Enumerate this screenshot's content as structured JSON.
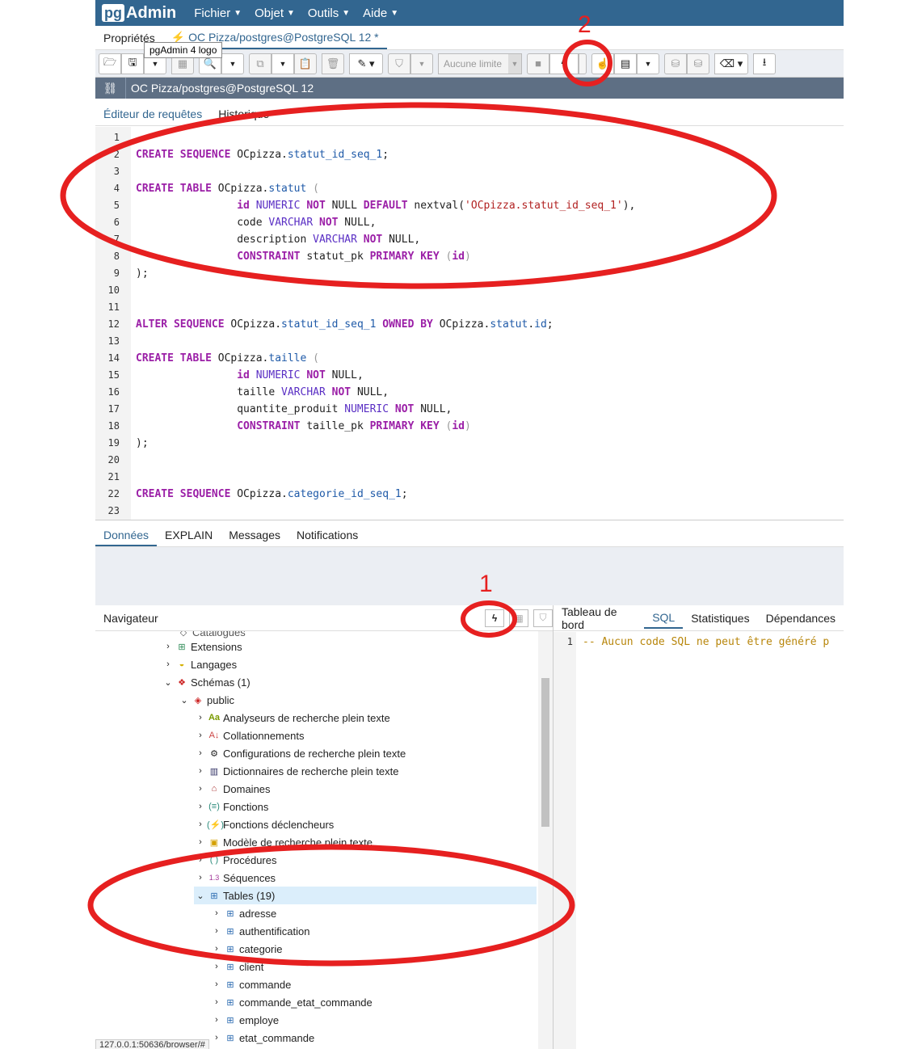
{
  "menubar": {
    "logo_pg": "pg",
    "logo_admin": "Admin",
    "items": [
      "Fichier",
      "Objet",
      "Outils",
      "Aide"
    ]
  },
  "tabs": {
    "properties": "Propriétés",
    "query": "⚡ OC Pizza/postgres@PostgreSQL 12 *",
    "tooltip": "pgAdmin 4 logo"
  },
  "toolbar": {
    "limit_placeholder": "Aucune limite"
  },
  "connection": {
    "label": "OC Pizza/postgres@PostgreSQL 12"
  },
  "editor_tabs": {
    "query_editor": "Éditeur de requêtes",
    "history": "Historique"
  },
  "editor": {
    "line_numbers": [
      "1",
      "2",
      "3",
      "4",
      "5",
      "6",
      "7",
      "8",
      "9",
      "10",
      "11",
      "12",
      "13",
      "14",
      "15",
      "16",
      "17",
      "18",
      "19",
      "20",
      "21",
      "22",
      "23"
    ]
  },
  "result_tabs": [
    "Données",
    "EXPLAIN",
    "Messages",
    "Notifications"
  ],
  "navigator": {
    "title": "Navigateur",
    "partial_top": "Catalogues",
    "items": [
      {
        "label": "Extensions"
      },
      {
        "label": "Langages"
      },
      {
        "label": "Schémas (1)"
      },
      {
        "label": "public"
      },
      {
        "label": "Analyseurs de recherche plein texte"
      },
      {
        "label": "Collationnements"
      },
      {
        "label": "Configurations de recherche plein texte"
      },
      {
        "label": "Dictionnaires de recherche plein texte"
      },
      {
        "label": "Domaines"
      },
      {
        "label": "Fonctions"
      },
      {
        "label": "Fonctions déclencheurs"
      },
      {
        "label": "Modèle de recherche plein texte"
      },
      {
        "label": "Procédures"
      },
      {
        "label": "Séquences"
      },
      {
        "label": "Tables (19)"
      },
      {
        "label": "adresse"
      },
      {
        "label": "authentification"
      },
      {
        "label": "categorie"
      },
      {
        "label": "client"
      },
      {
        "label": "commande"
      },
      {
        "label": "commande_etat_commande"
      },
      {
        "label": "employe"
      },
      {
        "label": "etat_commande"
      }
    ],
    "status_url": "127.0.0.1:50636/browser/#"
  },
  "right_panel": {
    "tabs": [
      "Tableau de bord",
      "SQL",
      "Statistiques",
      "Dépendances"
    ],
    "line_number": "1",
    "sql_comment": "-- Aucun code SQL ne peut être généré p"
  },
  "annotations": {
    "label_1": "1",
    "label_2": "2",
    "color": "#e62020"
  },
  "colors": {
    "menubar": "#326690",
    "keyword": "#9b1fa7",
    "type": "#5a2fc4",
    "identifier": "#1f5aa8",
    "string": "#b22222"
  }
}
